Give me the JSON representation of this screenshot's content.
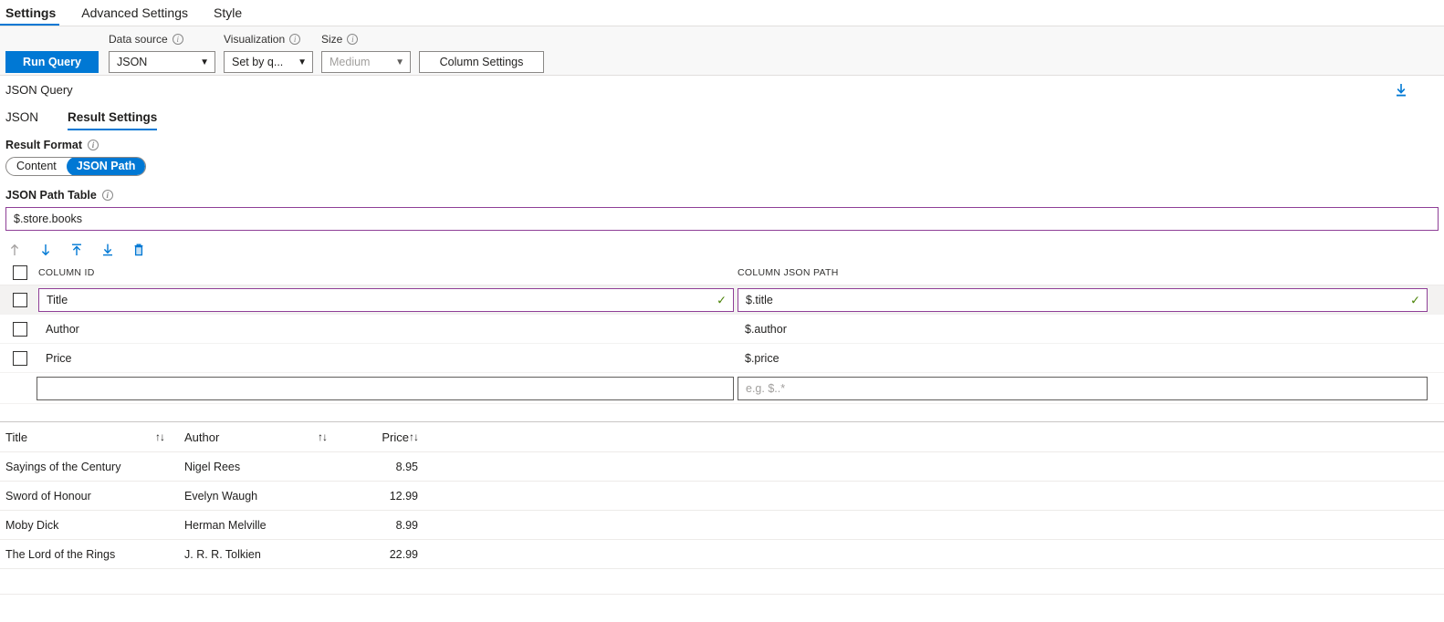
{
  "top_tabs": [
    {
      "label": "Settings",
      "active": true
    },
    {
      "label": "Advanced Settings",
      "active": false
    },
    {
      "label": "Style",
      "active": false
    }
  ],
  "command_bar": {
    "run_query_label": "Run Query",
    "data_source": {
      "label": "Data source",
      "value": "JSON"
    },
    "visualization": {
      "label": "Visualization",
      "value": "Set by q..."
    },
    "size": {
      "label": "Size",
      "value": "Medium"
    },
    "column_settings_label": "Column Settings"
  },
  "query_section": {
    "title": "JSON Query",
    "download_icon": "download-icon"
  },
  "sub_tabs": [
    {
      "label": "JSON",
      "active": false
    },
    {
      "label": "Result Settings",
      "active": true
    }
  ],
  "result_format": {
    "label": "Result Format",
    "options": [
      {
        "label": "Content",
        "selected": false
      },
      {
        "label": "JSON Path",
        "selected": true
      }
    ]
  },
  "json_path_table": {
    "label": "JSON Path Table",
    "value": "$.store.books",
    "toolbar": [
      {
        "name": "move-up-icon",
        "enabled": false
      },
      {
        "name": "move-down-icon",
        "enabled": true
      },
      {
        "name": "move-to-top-icon",
        "enabled": true
      },
      {
        "name": "move-to-bottom-icon",
        "enabled": true
      },
      {
        "name": "delete-icon",
        "enabled": true
      }
    ],
    "headers": {
      "column_id": "COLUMN ID",
      "column_json_path": "COLUMN JSON PATH"
    },
    "rows": [
      {
        "column_id": "Title",
        "json_path": "$.title",
        "editing": true,
        "valid": true
      },
      {
        "column_id": "Author",
        "json_path": "$.author",
        "editing": false,
        "valid": false
      },
      {
        "column_id": "Price",
        "json_path": "$.price",
        "editing": false,
        "valid": false
      }
    ],
    "new_row": {
      "column_id_placeholder": "",
      "json_path_placeholder": "e.g. $..*"
    }
  },
  "results_table": {
    "columns": [
      {
        "label": "Title",
        "sort_icon": "↑↓"
      },
      {
        "label": "Author",
        "sort_icon": "↑↓"
      },
      {
        "label": "Price",
        "sort_icon": "↑↓"
      }
    ],
    "rows": [
      {
        "title": "Sayings of the Century",
        "author": "Nigel Rees",
        "price": "8.95"
      },
      {
        "title": "Sword of Honour",
        "author": "Evelyn Waugh",
        "price": "12.99"
      },
      {
        "title": "Moby Dick",
        "author": "Herman Melville",
        "price": "8.99"
      },
      {
        "title": "The Lord of the Rings",
        "author": "J. R. R. Tolkien",
        "price": "22.99"
      }
    ]
  },
  "colors": {
    "accent": "#0078d4",
    "focus_border": "#8f3f97",
    "valid_check": "#498205",
    "selected_row": "#f3f2f1"
  }
}
